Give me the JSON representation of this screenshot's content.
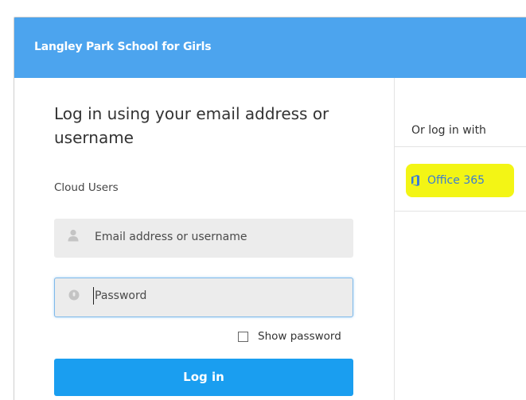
{
  "header": {
    "title": "Langley Park School for Girls",
    "color": "#4ca4ee"
  },
  "login": {
    "heading": "Log in using your email address or username",
    "section_label": "Cloud Users",
    "email_placeholder": "Email address or username",
    "password_placeholder": "Password",
    "show_password_label": "Show password",
    "show_password_checked": false,
    "button_label": "Log in",
    "button_color": "#1a9ef0"
  },
  "alt_login": {
    "heading": "Or log in with",
    "provider_label": "Office 365",
    "provider_icon": "office-365-icon",
    "highlight_color": "#f3f515"
  }
}
